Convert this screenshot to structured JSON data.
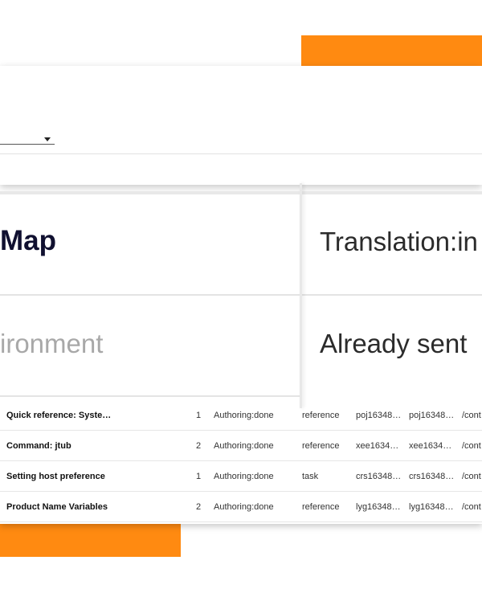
{
  "magnified": {
    "cell_map": "Map",
    "cell_translation": "Translation:in",
    "cell_environment": "ironment",
    "cell_already_sent": "Already sent"
  },
  "table": {
    "rows": [
      {
        "title": "Quick reference: System he…",
        "count": "1",
        "status": "Authoring:done",
        "type": "reference",
        "id1": "poj16348…",
        "id2": "poj16348…",
        "path": "/cont"
      },
      {
        "title": "Command: jtub",
        "count": "2",
        "status": "Authoring:done",
        "type": "reference",
        "id1": "xee1634…",
        "id2": "xee1634…",
        "path": "/cont"
      },
      {
        "title": "Setting host preference",
        "count": "1",
        "status": "Authoring:done",
        "type": "task",
        "id1": "crs16348…",
        "id2": "crs16348…",
        "path": "/cont"
      },
      {
        "title": "Product Name Variables",
        "count": "2",
        "status": "Authoring:done",
        "type": "reference",
        "id1": "lyg16348…",
        "id2": "lyg16348…",
        "path": "/cont"
      }
    ]
  },
  "colors": {
    "accent": "#ff8a11"
  }
}
